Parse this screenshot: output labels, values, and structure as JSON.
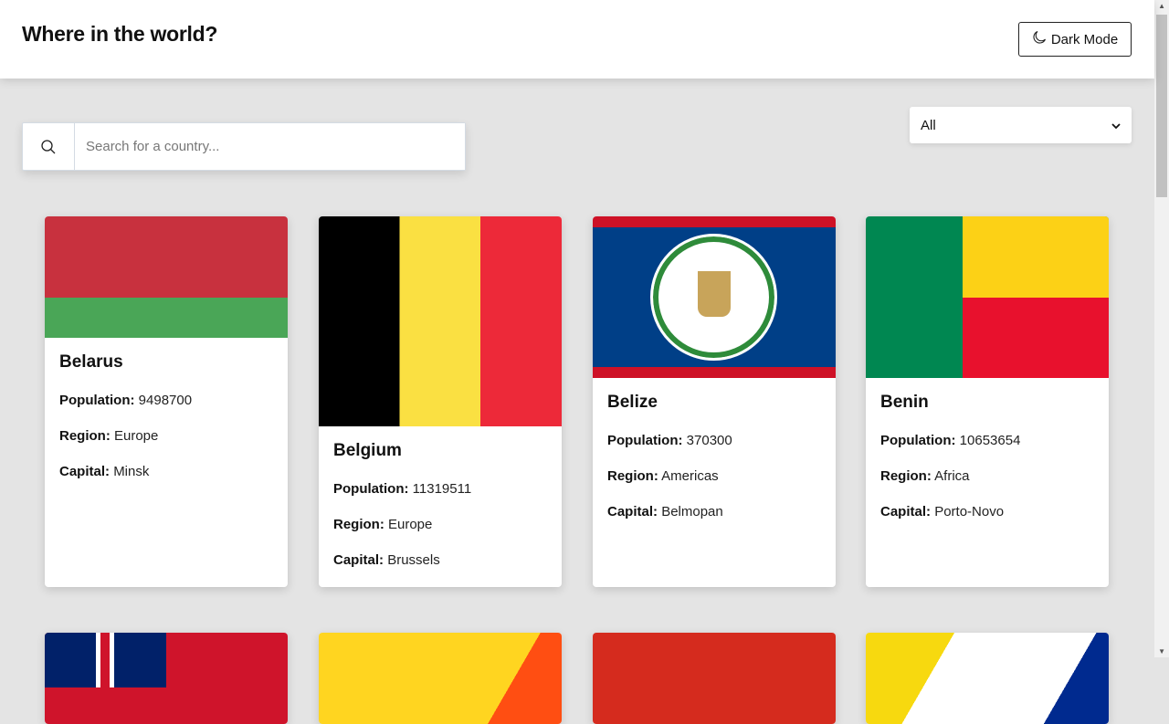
{
  "header": {
    "title": "Where in the world?",
    "dark_mode_label": "Dark Mode"
  },
  "search": {
    "placeholder": "Search for a country..."
  },
  "filter": {
    "selected": "All"
  },
  "labels": {
    "population": "Population:",
    "region": "Region:",
    "capital": "Capital:"
  },
  "countries": [
    {
      "name": "Belarus",
      "population": "9498700",
      "region": "Europe",
      "capital": "Minsk"
    },
    {
      "name": "Belgium",
      "population": "11319511",
      "region": "Europe",
      "capital": "Brussels"
    },
    {
      "name": "Belize",
      "population": "370300",
      "region": "Americas",
      "capital": "Belmopan"
    },
    {
      "name": "Benin",
      "population": "10653654",
      "region": "Africa",
      "capital": "Porto-Novo"
    }
  ]
}
